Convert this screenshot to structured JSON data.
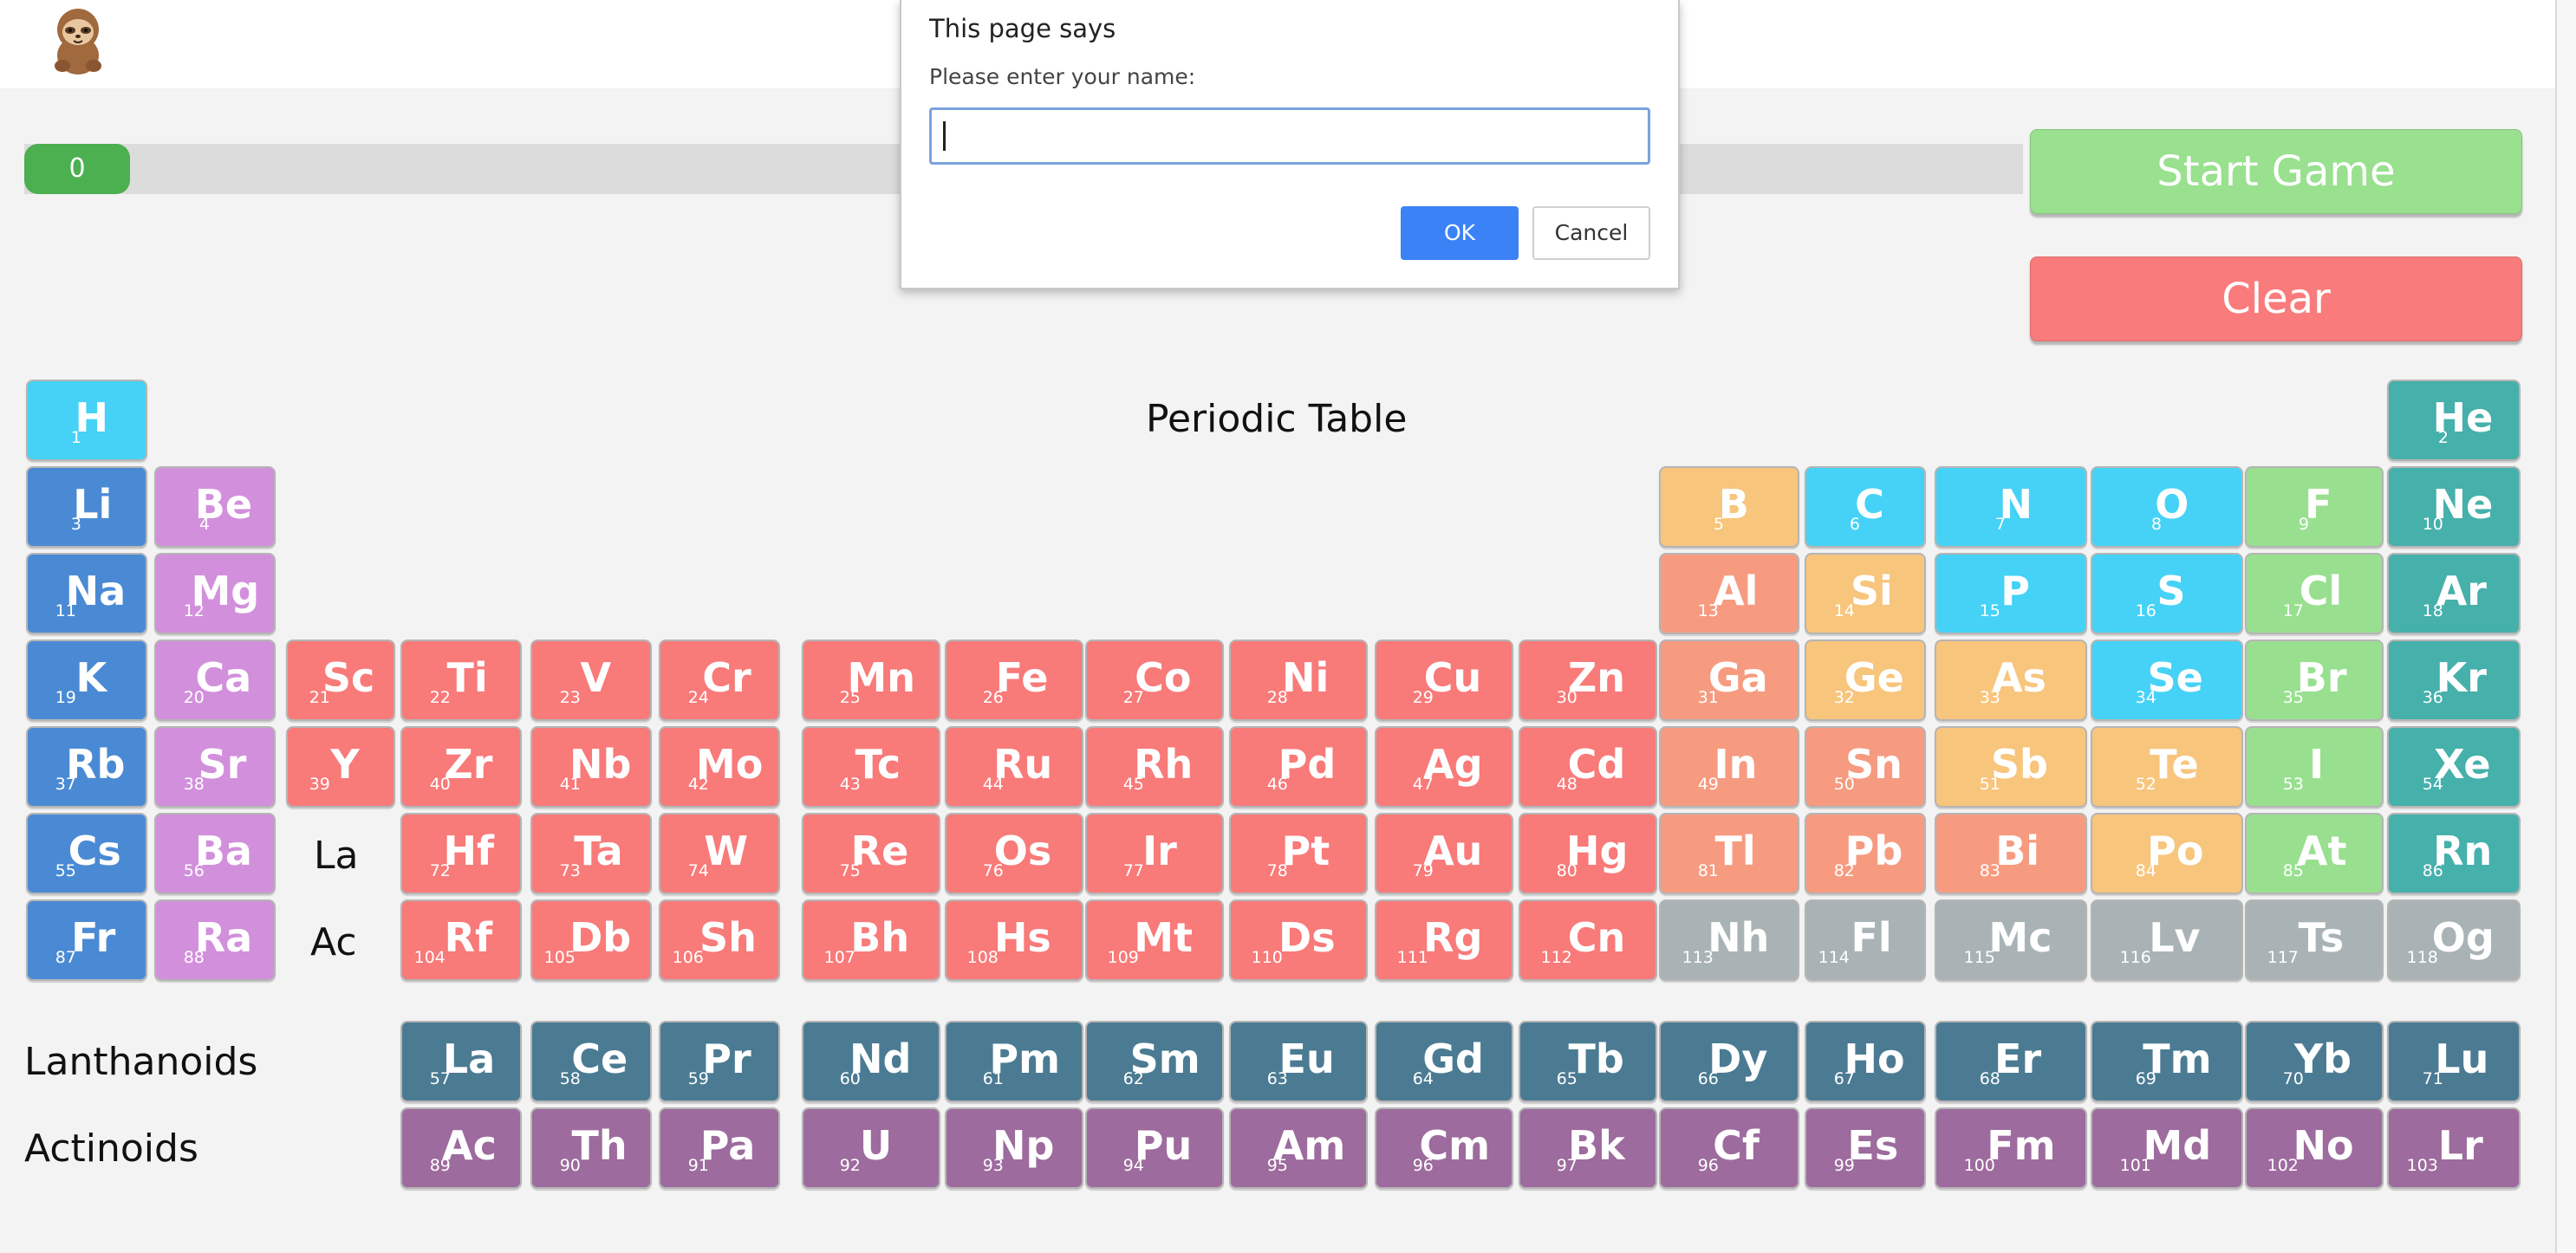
{
  "progress": {
    "value": "0",
    "fraction": 0.053
  },
  "buttons": {
    "start": "Start Game",
    "clear": "Clear"
  },
  "table_title": "Periodic Table",
  "labels": {
    "la": "La",
    "ac": "Ac",
    "lanthanoids": "Lanthanoids",
    "actinoids": "Actinoids"
  },
  "dialog": {
    "title": "This page says",
    "message": "Please enter your name:",
    "input_value": "",
    "ok": "OK",
    "cancel": "Cancel"
  },
  "colors": {
    "progress": "#4caf50",
    "start": "#99e08f",
    "clear": "#fa7b7b",
    "hydrogen": "#45d2f6",
    "alkali": "#4a8ad4",
    "alkaline": "#d28fdc",
    "transition": "#f87a79",
    "post_transition": "#f69b80",
    "metalloid": "#f8c57d",
    "nonmetal": "#45d2f6",
    "halogen": "#98e08f",
    "noble": "#46b0ab",
    "unknown": "#a9b3b6",
    "lanthanoid": "#4b7b93",
    "actinoid": "#9d6b9d"
  },
  "elements": [
    {
      "n": "1",
      "s": "H",
      "c": "h",
      "r": 1,
      "g": 1
    },
    {
      "n": "2",
      "s": "He",
      "c": "noble",
      "r": 1,
      "g": 18
    },
    {
      "n": "3",
      "s": "Li",
      "c": "alkali",
      "r": 2,
      "g": 1
    },
    {
      "n": "4",
      "s": "Be",
      "c": "alkaline",
      "r": 2,
      "g": 2
    },
    {
      "n": "5",
      "s": "B",
      "c": "metalloid",
      "r": 2,
      "g": 13
    },
    {
      "n": "6",
      "s": "C",
      "c": "nonmetal",
      "r": 2,
      "g": 14
    },
    {
      "n": "7",
      "s": "N",
      "c": "nonmetal",
      "r": 2,
      "g": 15
    },
    {
      "n": "8",
      "s": "O",
      "c": "nonmetal",
      "r": 2,
      "g": 16
    },
    {
      "n": "9",
      "s": "F",
      "c": "halogen",
      "r": 2,
      "g": 17
    },
    {
      "n": "10",
      "s": "Ne",
      "c": "noble",
      "r": 2,
      "g": 18
    },
    {
      "n": "11",
      "s": "Na",
      "c": "alkali",
      "r": 3,
      "g": 1
    },
    {
      "n": "12",
      "s": "Mg",
      "c": "alkaline",
      "r": 3,
      "g": 2
    },
    {
      "n": "13",
      "s": "Al",
      "c": "post",
      "r": 3,
      "g": 13
    },
    {
      "n": "14",
      "s": "Si",
      "c": "metalloid",
      "r": 3,
      "g": 14
    },
    {
      "n": "15",
      "s": "P",
      "c": "nonmetal",
      "r": 3,
      "g": 15
    },
    {
      "n": "16",
      "s": "S",
      "c": "nonmetal",
      "r": 3,
      "g": 16
    },
    {
      "n": "17",
      "s": "Cl",
      "c": "halogen",
      "r": 3,
      "g": 17
    },
    {
      "n": "18",
      "s": "Ar",
      "c": "noble",
      "r": 3,
      "g": 18
    },
    {
      "n": "19",
      "s": "K",
      "c": "alkali",
      "r": 4,
      "g": 1
    },
    {
      "n": "20",
      "s": "Ca",
      "c": "alkaline",
      "r": 4,
      "g": 2
    },
    {
      "n": "21",
      "s": "Sc",
      "c": "transition",
      "r": 4,
      "g": 3
    },
    {
      "n": "22",
      "s": "Ti",
      "c": "transition",
      "r": 4,
      "g": 4
    },
    {
      "n": "23",
      "s": "V",
      "c": "transition",
      "r": 4,
      "g": 5
    },
    {
      "n": "24",
      "s": "Cr",
      "c": "transition",
      "r": 4,
      "g": 6
    },
    {
      "n": "25",
      "s": "Mn",
      "c": "transition",
      "r": 4,
      "g": 7
    },
    {
      "n": "26",
      "s": "Fe",
      "c": "transition",
      "r": 4,
      "g": 8
    },
    {
      "n": "27",
      "s": "Co",
      "c": "transition",
      "r": 4,
      "g": 9
    },
    {
      "n": "28",
      "s": "Ni",
      "c": "transition",
      "r": 4,
      "g": 10
    },
    {
      "n": "29",
      "s": "Cu",
      "c": "transition",
      "r": 4,
      "g": 11
    },
    {
      "n": "30",
      "s": "Zn",
      "c": "transition",
      "r": 4,
      "g": 12
    },
    {
      "n": "31",
      "s": "Ga",
      "c": "post",
      "r": 4,
      "g": 13
    },
    {
      "n": "32",
      "s": "Ge",
      "c": "metalloid",
      "r": 4,
      "g": 14
    },
    {
      "n": "33",
      "s": "As",
      "c": "metalloid",
      "r": 4,
      "g": 15
    },
    {
      "n": "34",
      "s": "Se",
      "c": "nonmetal",
      "r": 4,
      "g": 16
    },
    {
      "n": "35",
      "s": "Br",
      "c": "halogen",
      "r": 4,
      "g": 17
    },
    {
      "n": "36",
      "s": "Kr",
      "c": "noble",
      "r": 4,
      "g": 18
    },
    {
      "n": "37",
      "s": "Rb",
      "c": "alkali",
      "r": 5,
      "g": 1
    },
    {
      "n": "38",
      "s": "Sr",
      "c": "alkaline",
      "r": 5,
      "g": 2
    },
    {
      "n": "39",
      "s": "Y",
      "c": "transition",
      "r": 5,
      "g": 3
    },
    {
      "n": "40",
      "s": "Zr",
      "c": "transition",
      "r": 5,
      "g": 4
    },
    {
      "n": "41",
      "s": "Nb",
      "c": "transition",
      "r": 5,
      "g": 5
    },
    {
      "n": "42",
      "s": "Mo",
      "c": "transition",
      "r": 5,
      "g": 6
    },
    {
      "n": "43",
      "s": "Tc",
      "c": "transition",
      "r": 5,
      "g": 7
    },
    {
      "n": "44",
      "s": "Ru",
      "c": "transition",
      "r": 5,
      "g": 8
    },
    {
      "n": "45",
      "s": "Rh",
      "c": "transition",
      "r": 5,
      "g": 9
    },
    {
      "n": "46",
      "s": "Pd",
      "c": "transition",
      "r": 5,
      "g": 10
    },
    {
      "n": "47",
      "s": "Ag",
      "c": "transition",
      "r": 5,
      "g": 11
    },
    {
      "n": "48",
      "s": "Cd",
      "c": "transition",
      "r": 5,
      "g": 12
    },
    {
      "n": "49",
      "s": "In",
      "c": "post",
      "r": 5,
      "g": 13
    },
    {
      "n": "50",
      "s": "Sn",
      "c": "post",
      "r": 5,
      "g": 14
    },
    {
      "n": "51",
      "s": "Sb",
      "c": "metalloid",
      "r": 5,
      "g": 15
    },
    {
      "n": "52",
      "s": "Te",
      "c": "metalloid",
      "r": 5,
      "g": 16
    },
    {
      "n": "53",
      "s": "I",
      "c": "halogen",
      "r": 5,
      "g": 17
    },
    {
      "n": "54",
      "s": "Xe",
      "c": "noble",
      "r": 5,
      "g": 18
    },
    {
      "n": "55",
      "s": "Cs",
      "c": "alkali",
      "r": 6,
      "g": 1
    },
    {
      "n": "56",
      "s": "Ba",
      "c": "alkaline",
      "r": 6,
      "g": 2
    },
    {
      "n": "72",
      "s": "Hf",
      "c": "transition",
      "r": 6,
      "g": 4
    },
    {
      "n": "73",
      "s": "Ta",
      "c": "transition",
      "r": 6,
      "g": 5
    },
    {
      "n": "74",
      "s": "W",
      "c": "transition",
      "r": 6,
      "g": 6
    },
    {
      "n": "75",
      "s": "Re",
      "c": "transition",
      "r": 6,
      "g": 7
    },
    {
      "n": "76",
      "s": "Os",
      "c": "transition",
      "r": 6,
      "g": 8
    },
    {
      "n": "77",
      "s": "Ir",
      "c": "transition",
      "r": 6,
      "g": 9
    },
    {
      "n": "78",
      "s": "Pt",
      "c": "transition",
      "r": 6,
      "g": 10
    },
    {
      "n": "79",
      "s": "Au",
      "c": "transition",
      "r": 6,
      "g": 11
    },
    {
      "n": "80",
      "s": "Hg",
      "c": "transition",
      "r": 6,
      "g": 12
    },
    {
      "n": "81",
      "s": "Tl",
      "c": "post",
      "r": 6,
      "g": 13
    },
    {
      "n": "82",
      "s": "Pb",
      "c": "post",
      "r": 6,
      "g": 14
    },
    {
      "n": "83",
      "s": "Bi",
      "c": "post",
      "r": 6,
      "g": 15
    },
    {
      "n": "84",
      "s": "Po",
      "c": "metalloid",
      "r": 6,
      "g": 16
    },
    {
      "n": "85",
      "s": "At",
      "c": "halogen",
      "r": 6,
      "g": 17
    },
    {
      "n": "86",
      "s": "Rn",
      "c": "noble",
      "r": 6,
      "g": 18
    },
    {
      "n": "87",
      "s": "Fr",
      "c": "alkali",
      "r": 7,
      "g": 1
    },
    {
      "n": "88",
      "s": "Ra",
      "c": "alkaline",
      "r": 7,
      "g": 2
    },
    {
      "n": "104",
      "s": "Rf",
      "c": "transition",
      "r": 7,
      "g": 4
    },
    {
      "n": "105",
      "s": "Db",
      "c": "transition",
      "r": 7,
      "g": 5
    },
    {
      "n": "106",
      "s": "Sh",
      "c": "transition",
      "r": 7,
      "g": 6
    },
    {
      "n": "107",
      "s": "Bh",
      "c": "transition",
      "r": 7,
      "g": 7
    },
    {
      "n": "108",
      "s": "Hs",
      "c": "transition",
      "r": 7,
      "g": 8
    },
    {
      "n": "109",
      "s": "Mt",
      "c": "transition",
      "r": 7,
      "g": 9
    },
    {
      "n": "110",
      "s": "Ds",
      "c": "transition",
      "r": 7,
      "g": 10
    },
    {
      "n": "111",
      "s": "Rg",
      "c": "transition",
      "r": 7,
      "g": 11
    },
    {
      "n": "112",
      "s": "Cn",
      "c": "transition",
      "r": 7,
      "g": 12
    },
    {
      "n": "113",
      "s": "Nh",
      "c": "unknown",
      "r": 7,
      "g": 13
    },
    {
      "n": "114",
      "s": "Fl",
      "c": "unknown",
      "r": 7,
      "g": 14
    },
    {
      "n": "115",
      "s": "Mc",
      "c": "unknown",
      "r": 7,
      "g": 15
    },
    {
      "n": "116",
      "s": "Lv",
      "c": "unknown",
      "r": 7,
      "g": 16
    },
    {
      "n": "117",
      "s": "Ts",
      "c": "unknown",
      "r": 7,
      "g": 17
    },
    {
      "n": "118",
      "s": "Og",
      "c": "unknown",
      "r": 7,
      "g": 18
    },
    {
      "n": "57",
      "s": "La",
      "c": "lanth",
      "r": 9,
      "g": 4
    },
    {
      "n": "58",
      "s": "Ce",
      "c": "lanth",
      "r": 9,
      "g": 5
    },
    {
      "n": "59",
      "s": "Pr",
      "c": "lanth",
      "r": 9,
      "g": 6
    },
    {
      "n": "60",
      "s": "Nd",
      "c": "lanth",
      "r": 9,
      "g": 7
    },
    {
      "n": "61",
      "s": "Pm",
      "c": "lanth",
      "r": 9,
      "g": 8
    },
    {
      "n": "62",
      "s": "Sm",
      "c": "lanth",
      "r": 9,
      "g": 9
    },
    {
      "n": "63",
      "s": "Eu",
      "c": "lanth",
      "r": 9,
      "g": 10
    },
    {
      "n": "64",
      "s": "Gd",
      "c": "lanth",
      "r": 9,
      "g": 11
    },
    {
      "n": "65",
      "s": "Tb",
      "c": "lanth",
      "r": 9,
      "g": 12
    },
    {
      "n": "66",
      "s": "Dy",
      "c": "lanth",
      "r": 9,
      "g": 13
    },
    {
      "n": "67",
      "s": "Ho",
      "c": "lanth",
      "r": 9,
      "g": 14
    },
    {
      "n": "68",
      "s": "Er",
      "c": "lanth",
      "r": 9,
      "g": 15
    },
    {
      "n": "69",
      "s": "Tm",
      "c": "lanth",
      "r": 9,
      "g": 16
    },
    {
      "n": "70",
      "s": "Yb",
      "c": "lanth",
      "r": 9,
      "g": 17
    },
    {
      "n": "71",
      "s": "Lu",
      "c": "lanth",
      "r": 9,
      "g": 18
    },
    {
      "n": "89",
      "s": "Ac",
      "c": "actin",
      "r": 10,
      "g": 4
    },
    {
      "n": "90",
      "s": "Th",
      "c": "actin",
      "r": 10,
      "g": 5
    },
    {
      "n": "91",
      "s": "Pa",
      "c": "actin",
      "r": 10,
      "g": 6
    },
    {
      "n": "92",
      "s": "U",
      "c": "actin",
      "r": 10,
      "g": 7
    },
    {
      "n": "93",
      "s": "Np",
      "c": "actin",
      "r": 10,
      "g": 8
    },
    {
      "n": "94",
      "s": "Pu",
      "c": "actin",
      "r": 10,
      "g": 9
    },
    {
      "n": "95",
      "s": "Am",
      "c": "actin",
      "r": 10,
      "g": 10
    },
    {
      "n": "96",
      "s": "Cm",
      "c": "actin",
      "r": 10,
      "g": 11
    },
    {
      "n": "97",
      "s": "Bk",
      "c": "actin",
      "r": 10,
      "g": 12
    },
    {
      "n": "96",
      "s": "Cf",
      "c": "actin",
      "r": 10,
      "g": 13
    },
    {
      "n": "99",
      "s": "Es",
      "c": "actin",
      "r": 10,
      "g": 14
    },
    {
      "n": "100",
      "s": "Fm",
      "c": "actin",
      "r": 10,
      "g": 15
    },
    {
      "n": "101",
      "s": "Md",
      "c": "actin",
      "r": 10,
      "g": 16
    },
    {
      "n": "102",
      "s": "No",
      "c": "actin",
      "r": 10,
      "g": 17
    },
    {
      "n": "103",
      "s": "Lr",
      "c": "actin",
      "r": 10,
      "g": 18
    }
  ]
}
